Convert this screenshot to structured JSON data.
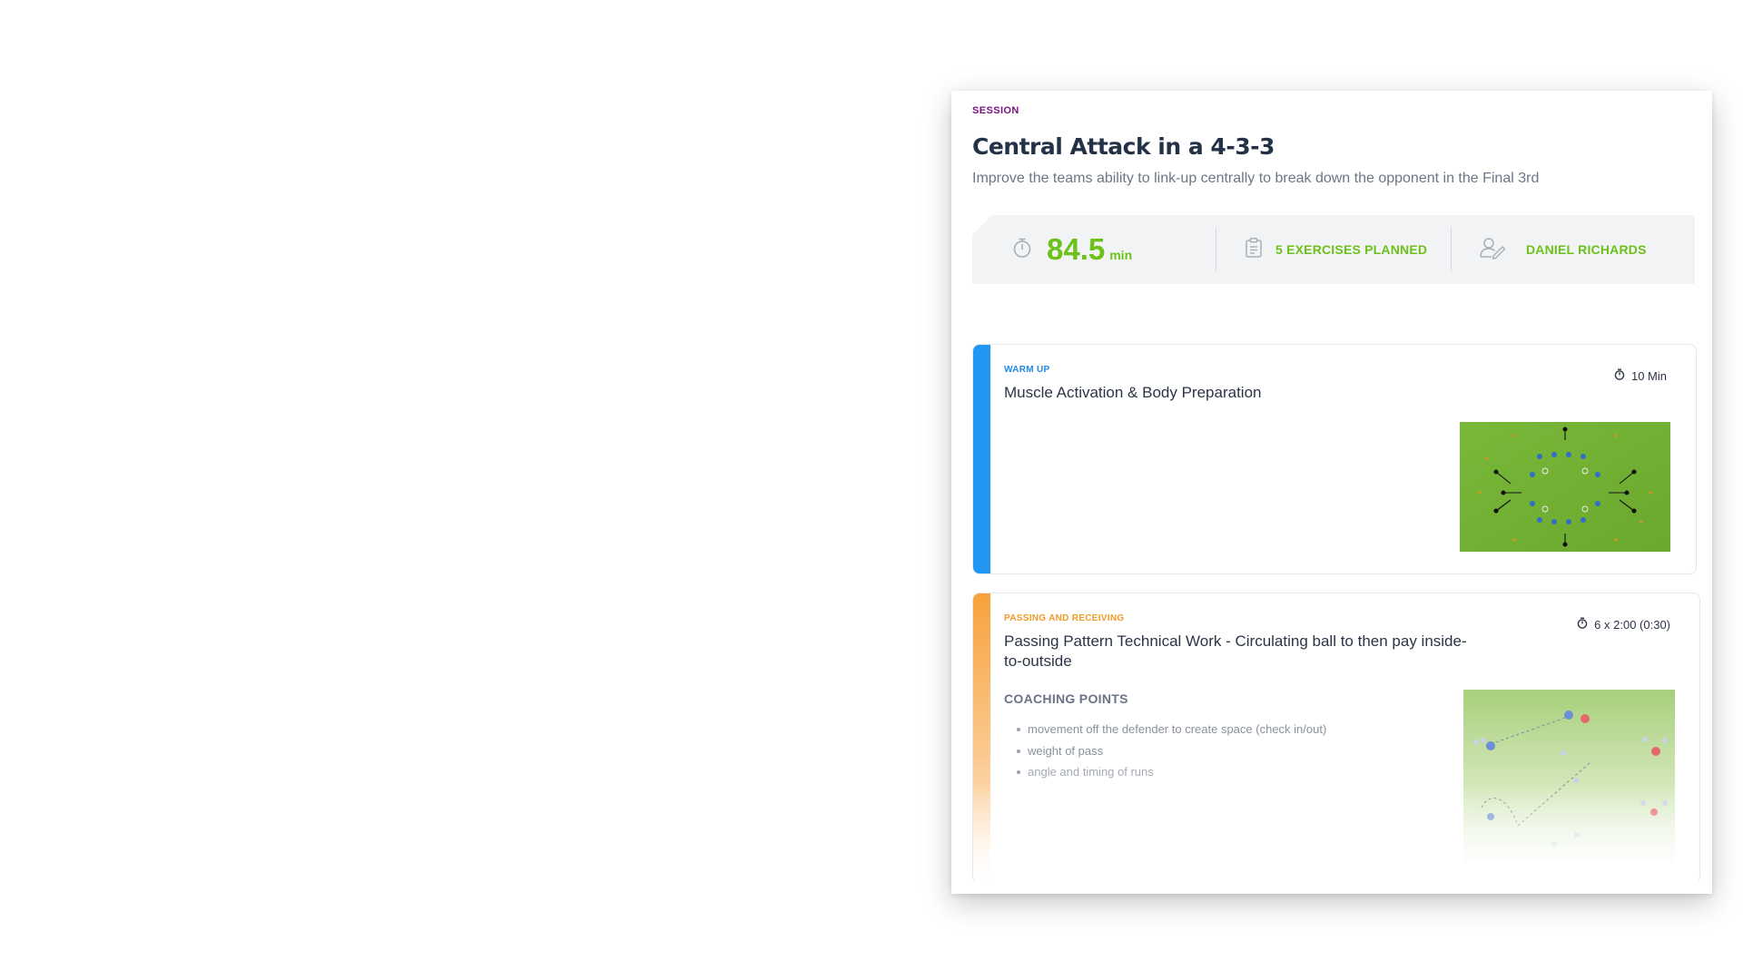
{
  "session": {
    "eyebrow": "SESSION",
    "title": "Central Attack in a 4-3-3",
    "subtitle": "Improve the teams ability to link-up centrally to break down the opponent in the Final 3rd"
  },
  "stats": {
    "duration_value": "84.5",
    "duration_unit": "min",
    "exercises_label": "5 EXERCISES PLANNED",
    "coach_name": "DANIEL RICHARDS",
    "icons": [
      "stopwatch-icon",
      "clipboard-icon",
      "coach-icon"
    ],
    "accent_color": "#6cc11a"
  },
  "exercises": [
    {
      "category": "WARM UP",
      "title": "Muscle Activation & Body Preparation",
      "time": "10 Min",
      "color": "#2196f3"
    },
    {
      "category": "PASSING AND RECEIVING",
      "title": "Passing Pattern Technical Work - Circulating ball to then pay inside-to-outside",
      "time": "6 x 2:00 (0:30)",
      "color": "#f7a23c",
      "coaching_points_title": "COACHING POINTS",
      "coaching_points": [
        "movement off the defender to create space (check in/out)",
        "weight of pass",
        "angle and timing of runs"
      ]
    }
  ]
}
